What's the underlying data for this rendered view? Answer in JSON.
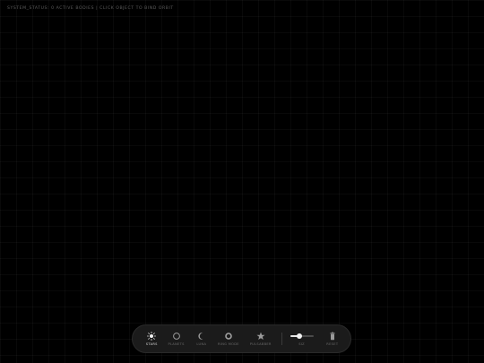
{
  "status": {
    "text": "System_Status: 0 Active Bodies | Click object to bind orbit"
  },
  "dock": {
    "tools": [
      {
        "id": "stars",
        "label": "Stars",
        "icon": "sun-icon",
        "active": true
      },
      {
        "id": "planets",
        "label": "Planets",
        "icon": "ring-outline-icon",
        "active": false
      },
      {
        "id": "luna",
        "label": "Luna",
        "icon": "moon-icon",
        "active": false
      },
      {
        "id": "ring",
        "label": "Ring Mode",
        "icon": "donut-icon",
        "active": false
      },
      {
        "id": "pulsar",
        "label": "Pulsabber",
        "icon": "star-icon",
        "active": false
      }
    ],
    "size": {
      "label": "Siz",
      "value": 0.4
    },
    "reset": {
      "label": "Reset",
      "icon": "trash-icon"
    }
  },
  "colors": {
    "background": "#000000",
    "dock": "#1b1b1b",
    "active_label": "#d9d9d9",
    "inactive_label": "#6a6a6a"
  }
}
